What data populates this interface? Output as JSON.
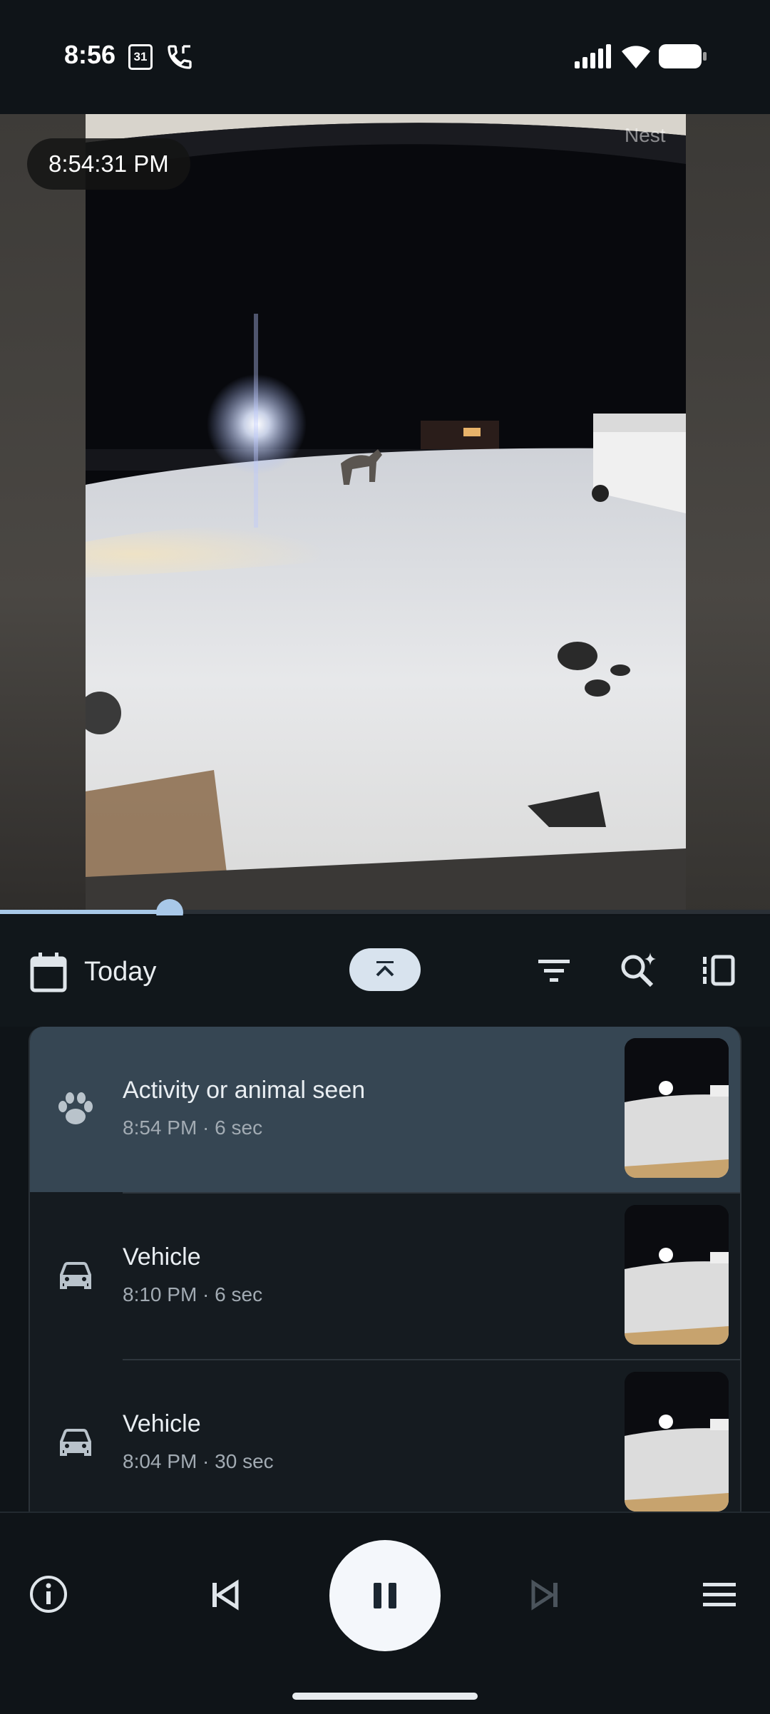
{
  "status_bar": {
    "time": "8:56",
    "calendar_day": "31",
    "icons": [
      "calendar-icon",
      "call-icon",
      "signal-icon",
      "wifi-icon",
      "battery-icon"
    ]
  },
  "camera": {
    "timestamp": "8:54:31 PM",
    "watermark": "Nest",
    "playback_progress": 0.22
  },
  "toolbar": {
    "date_label": "Today",
    "icons": [
      "calendar-icon",
      "collapse-up-icon",
      "filter-icon",
      "search-sparkle-icon",
      "panel-toggle-icon"
    ]
  },
  "events": [
    {
      "title": "Activity or animal seen",
      "meta": "8:54 PM · 6 sec",
      "icon": "paw-icon",
      "selected": true
    },
    {
      "title": "Vehicle",
      "meta": "8:10 PM · 6 sec",
      "icon": "car-icon",
      "selected": false
    },
    {
      "title": "Vehicle",
      "meta": "8:04 PM · 30 sec",
      "icon": "car-icon",
      "selected": false
    }
  ],
  "controls": {
    "icons": [
      "info-icon",
      "skip-previous-icon",
      "pause-icon",
      "skip-next-icon",
      "menu-icon"
    ]
  },
  "colors": {
    "background": "#0f1418",
    "selected_row": "#364653",
    "accent": "#a8c8e8"
  }
}
